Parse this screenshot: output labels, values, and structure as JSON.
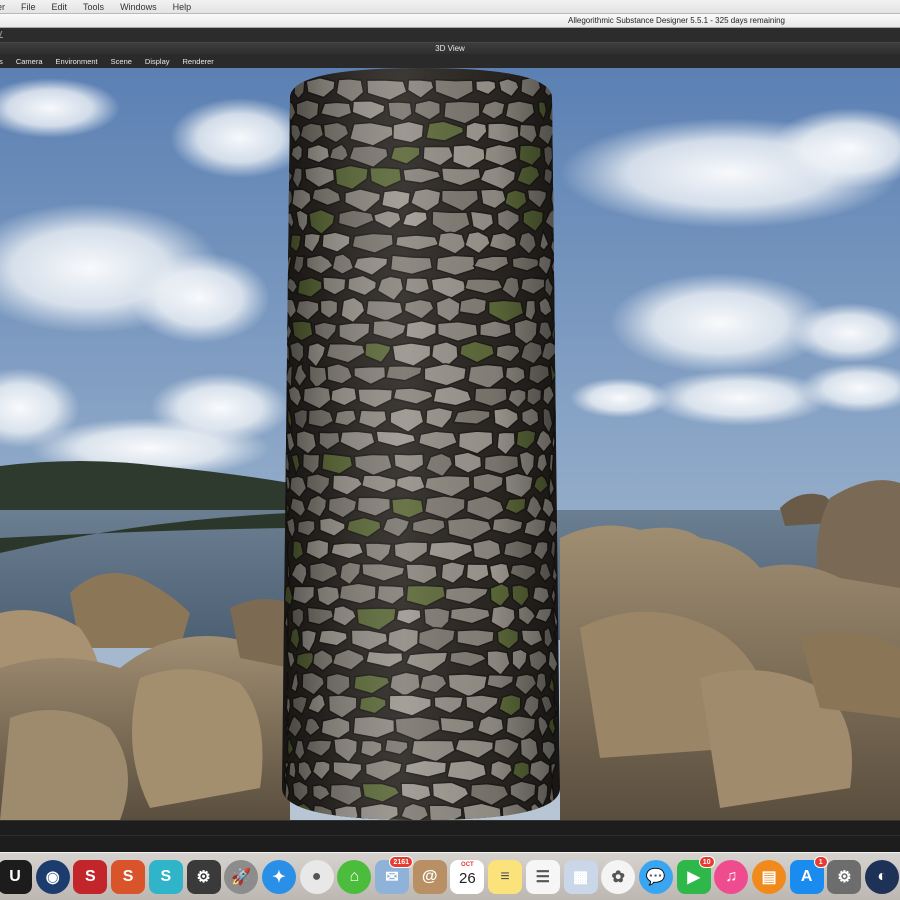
{
  "menubar": {
    "items": [
      "er",
      "File",
      "Edit",
      "Tools",
      "Windows",
      "Help"
    ]
  },
  "app": {
    "window_title": "Allegorithmic Substance Designer 5.5.1 - 325 days remaining"
  },
  "panel": {
    "title": "3D View",
    "menu": [
      "ts",
      "Camera",
      "Environment",
      "Scene",
      "Display",
      "Renderer"
    ]
  },
  "colors": {
    "sky_top": "#5d84b8",
    "sky_mid": "#9fb8d6",
    "sea": "#5e7387",
    "rock": "#8a7a62",
    "stone": "#8e8a82",
    "grout": "#2e2a26",
    "moss": "#5d6a3a"
  },
  "dock": {
    "icons": [
      {
        "name": "unreal-engine-icon",
        "glyph": "U",
        "bg": "#1c1c1c"
      },
      {
        "name": "cinema4d-icon",
        "glyph": "◉",
        "bg": "#1d3c6e"
      },
      {
        "name": "substance-painter-icon",
        "glyph": "S",
        "bg": "#c3262a"
      },
      {
        "name": "substance-designer-icon",
        "glyph": "S",
        "bg": "#d9542a"
      },
      {
        "name": "substance-bitmap-icon",
        "glyph": "S",
        "bg": "#2fb4c9"
      },
      {
        "name": "substance-player-icon",
        "glyph": "⚙",
        "bg": "#3a3a3a"
      },
      {
        "name": "launchpad-icon",
        "glyph": "🚀",
        "bg": "#8c8c8c"
      },
      {
        "name": "safari-icon",
        "glyph": "✦",
        "bg": "#2a8fe6"
      },
      {
        "name": "chrome-icon",
        "glyph": "●",
        "bg": "#e8e8e8"
      },
      {
        "name": "app-store-green-icon",
        "glyph": "⌂",
        "bg": "#4cbc3c"
      },
      {
        "name": "mail-stamp-icon",
        "glyph": "✉",
        "bg": "#8fb2d9",
        "badge": "2161"
      },
      {
        "name": "contacts-icon",
        "glyph": "@",
        "bg": "#b89063"
      },
      {
        "name": "calendar-icon",
        "glyph": "",
        "bg": "#ffffff",
        "month": "OCT",
        "day": "26"
      },
      {
        "name": "notes-icon",
        "glyph": "≡",
        "bg": "#fbe27a"
      },
      {
        "name": "reminders-icon",
        "glyph": "☰",
        "bg": "#f6f6f6"
      },
      {
        "name": "preview-icon",
        "glyph": "▦",
        "bg": "#c9d7e8"
      },
      {
        "name": "photos-icon",
        "glyph": "✿",
        "bg": "#f4f4f4"
      },
      {
        "name": "messages-icon",
        "glyph": "💬",
        "bg": "#3aa6f2"
      },
      {
        "name": "facetime-icon",
        "glyph": "▶",
        "bg": "#2fb84a",
        "badge": "10"
      },
      {
        "name": "itunes-icon",
        "glyph": "♫",
        "bg": "#ee4c8e"
      },
      {
        "name": "ibooks-icon",
        "glyph": "▤",
        "bg": "#f08a1c"
      },
      {
        "name": "app-store-icon",
        "glyph": "A",
        "bg": "#1a8cf0",
        "badge": "1"
      },
      {
        "name": "system-preferences-icon",
        "glyph": "⚙",
        "bg": "#6d6d6d"
      },
      {
        "name": "macos-icon",
        "glyph": "◐",
        "bg": "#1e3156"
      }
    ]
  }
}
